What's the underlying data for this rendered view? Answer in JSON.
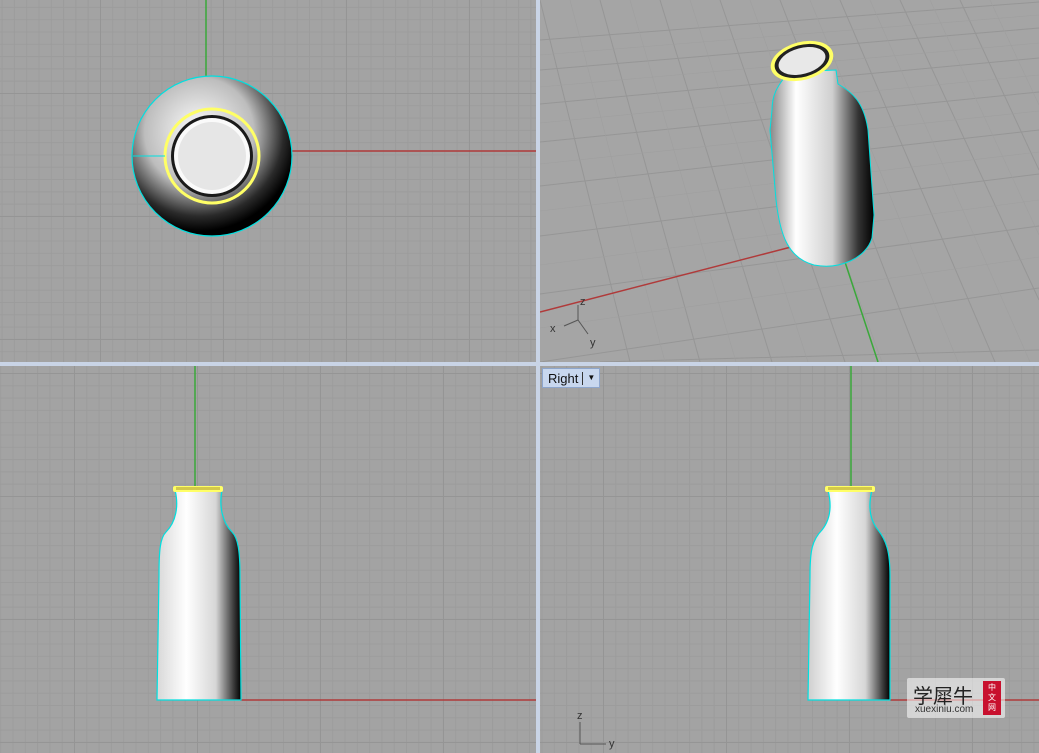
{
  "viewports": {
    "top": {},
    "perspective": {
      "axis_triad": {
        "x": "x",
        "y": "y",
        "z": "z"
      }
    },
    "front": {},
    "right": {
      "title": "Right",
      "dropdown_icon": "chevron-down-icon",
      "axis_triad": {
        "y": "y",
        "z": "z"
      }
    }
  },
  "watermark": {
    "chinese": "学犀牛",
    "site": "xuexiniu.com",
    "badge": [
      "中",
      "文",
      "网"
    ]
  },
  "colors": {
    "viewport_bg": "#a3a3a3",
    "x_axis": "#b03a3a",
    "y_axis": "#3aa83a",
    "selection_outline": "#00e0e0",
    "highlight_edge": "#ffff66",
    "active_tab": "#c8d7ee"
  }
}
